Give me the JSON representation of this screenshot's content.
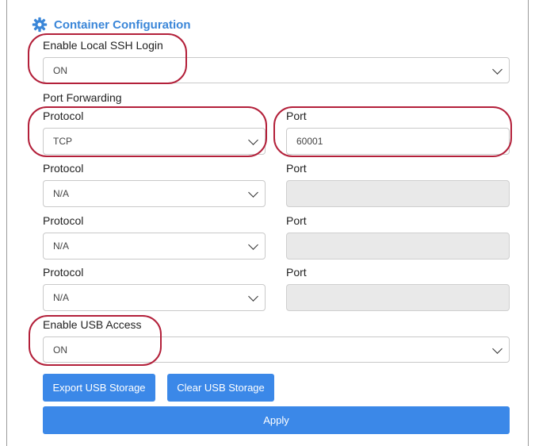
{
  "section": {
    "title": "Container Configuration",
    "icon": "gear-icon"
  },
  "ssh": {
    "label": "Enable Local SSH Login",
    "value": "ON"
  },
  "port_forwarding": {
    "label": "Port Forwarding",
    "rows": [
      {
        "protocol_label": "Protocol",
        "protocol_value": "TCP",
        "port_label": "Port",
        "port_value": "60001",
        "port_enabled": true
      },
      {
        "protocol_label": "Protocol",
        "protocol_value": "N/A",
        "port_label": "Port",
        "port_value": "",
        "port_enabled": false
      },
      {
        "protocol_label": "Protocol",
        "protocol_value": "N/A",
        "port_label": "Port",
        "port_value": "",
        "port_enabled": false
      },
      {
        "protocol_label": "Protocol",
        "protocol_value": "N/A",
        "port_label": "Port",
        "port_value": "",
        "port_enabled": false
      }
    ]
  },
  "usb": {
    "label": "Enable USB Access",
    "value": "ON"
  },
  "buttons": {
    "export": "Export USB Storage",
    "clear": "Clear USB Storage",
    "apply": "Apply"
  },
  "colors": {
    "accent": "#3b88e8",
    "title": "#3a86d8",
    "highlight": "#b3203a",
    "disabled_bg": "#e9e9e9"
  }
}
